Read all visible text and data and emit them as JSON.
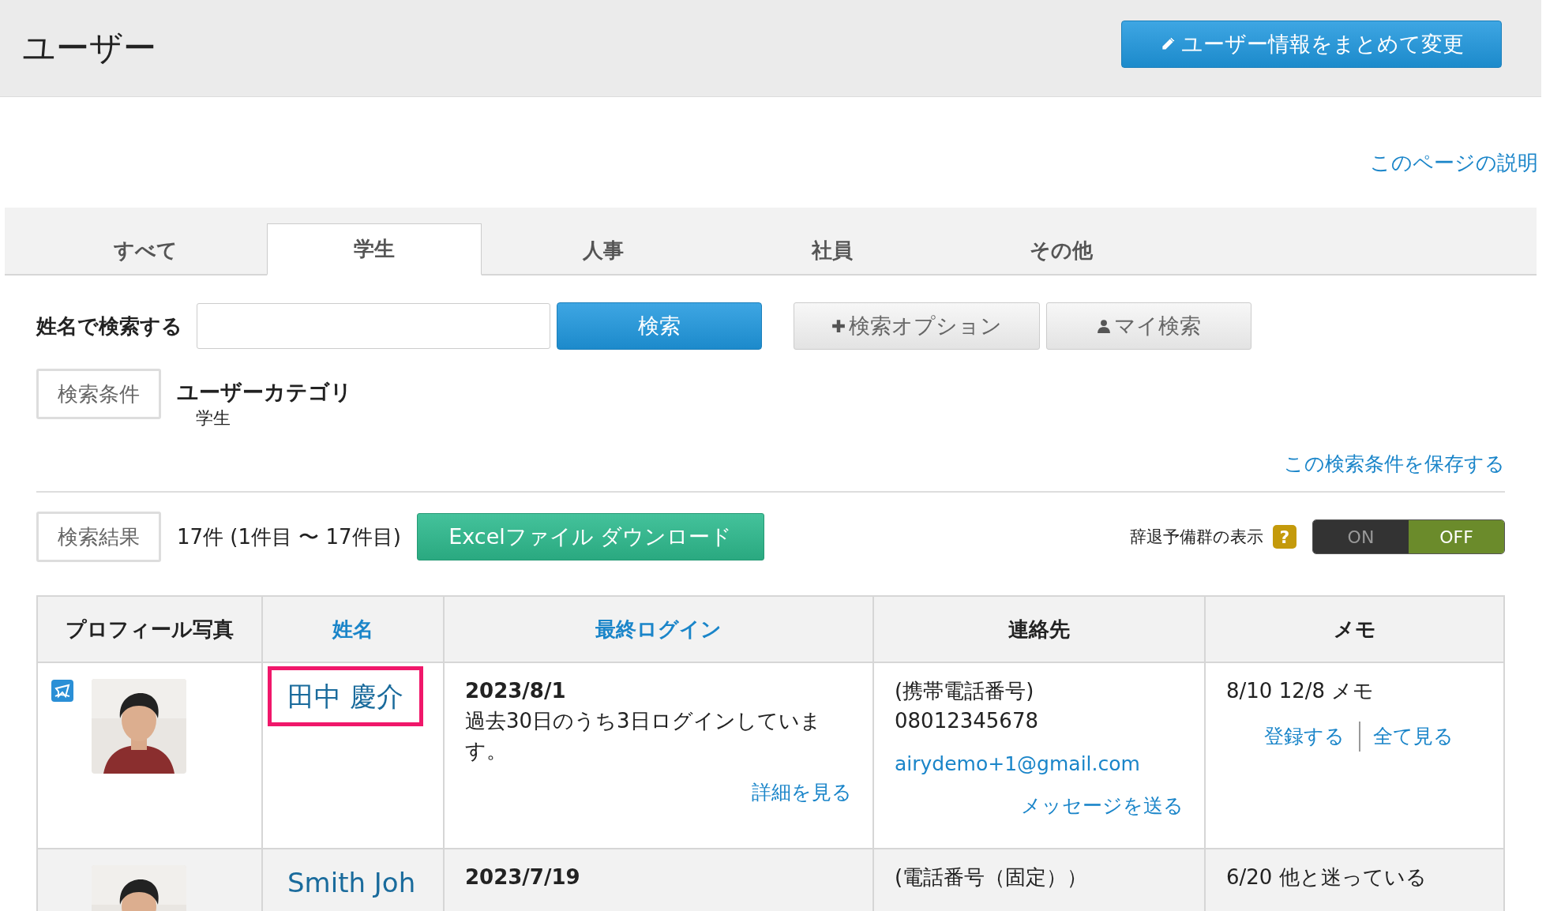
{
  "header": {
    "title": "ユーザー",
    "bulk_edit_button": "ユーザー情報をまとめて変更"
  },
  "help_link": "このページの説明",
  "tabs": [
    {
      "label": "すべて",
      "selected": false
    },
    {
      "label": "学生",
      "selected": true
    },
    {
      "label": "人事",
      "selected": false
    },
    {
      "label": "社員",
      "selected": false
    },
    {
      "label": "その他",
      "selected": false
    }
  ],
  "search": {
    "label": "姓名で検索する",
    "search_button": "検索",
    "options_button": "検索オプション",
    "my_search_button": "マイ検索"
  },
  "conditions": {
    "badge": "検索条件",
    "category_title": "ユーザーカテゴリ",
    "category_value": "学生",
    "save_link": "この検索条件を保存する"
  },
  "results": {
    "badge": "検索結果",
    "count": "17件 (1件目 〜 17件目)",
    "excel_button": "Excelファイル ダウンロード",
    "toggle_label": "辞退予備群の表示",
    "help_mark": "?",
    "toggle": [
      {
        "label": "ON",
        "selected": false
      },
      {
        "label": "OFF",
        "selected": true
      }
    ]
  },
  "table": {
    "columns": [
      {
        "label": "プロフィール写真",
        "sortable": false
      },
      {
        "label": "姓名",
        "sortable": true
      },
      {
        "label": "最終ログイン",
        "sortable": true
      },
      {
        "label": "連絡先",
        "sortable": false
      },
      {
        "label": "メモ",
        "sortable": false
      }
    ],
    "rows": [
      {
        "highlighted": true,
        "flagged": true,
        "name": "田中 慶介",
        "login_date": "2023/8/1",
        "login_note": "過去30日のうち3日ログインしています。",
        "details_link": "詳細を見る",
        "phone_type": "(携帯電話番号)",
        "phone": "08012345678",
        "email": "airydemo+1@gmail.com",
        "message_link": "メッセージを送る",
        "memo": "8/10 12/8 メモ",
        "memo_links": [
          "登録する",
          "全て見る"
        ]
      },
      {
        "highlighted": false,
        "flagged": false,
        "name": "Smith Joh",
        "login_date": "2023/7/19",
        "phone_type": "(電話番号（固定））",
        "memo": "6/20 他と迷っている"
      }
    ]
  }
}
